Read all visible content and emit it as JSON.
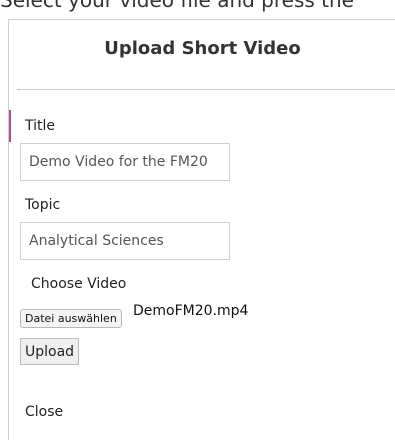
{
  "background": {
    "instruction_text": "Select your video file and press the"
  },
  "modal": {
    "title": "Upload Short Video",
    "fields": {
      "title_label": "Title",
      "title_value": "Demo Video for the FM20",
      "topic_label": "Topic",
      "topic_value": "Analytical Sciences",
      "video_label": "Choose Video"
    },
    "file_picker": {
      "button_label": "Datei auswählen",
      "selected_file": "DemoFM20.mp4"
    },
    "upload_button": "Upload",
    "close_label": "Close"
  },
  "colors": {
    "accent": "#b5488f",
    "border": "#cfcfcf"
  }
}
